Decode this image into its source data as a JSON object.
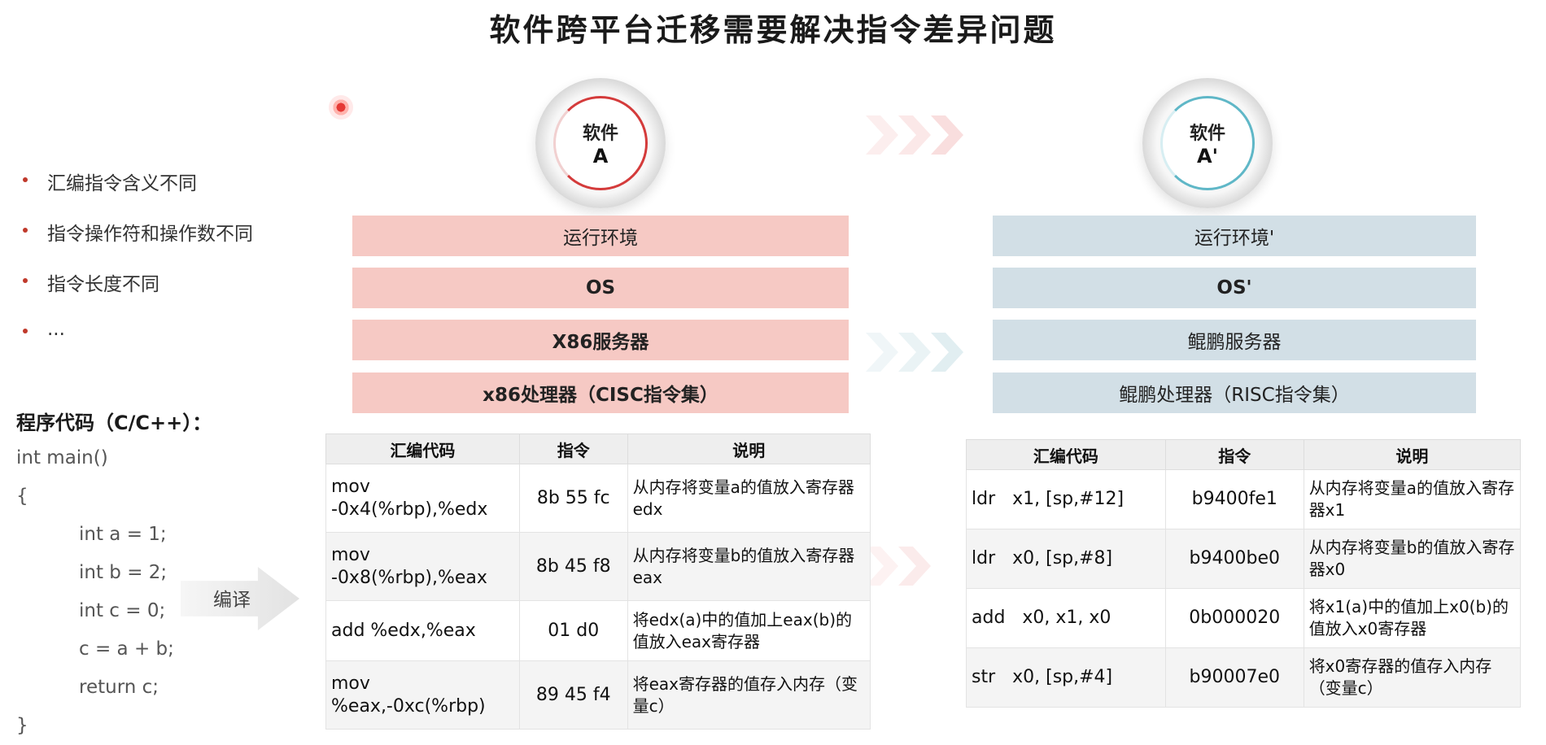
{
  "title": "软件跨平台迁移需要解决指令差异问题",
  "bullets": [
    "汇编指令含义不同",
    "指令操作符和操作数不同",
    "指令长度不同",
    "..."
  ],
  "code": {
    "title": "程序代码（C/C++）：",
    "lines": [
      "int main()",
      "{",
      "int a = 1;",
      "int b = 2;",
      "int c = 0;",
      "c = a + b;",
      "return c;",
      "}"
    ]
  },
  "compile_label": "编译",
  "left": {
    "software": {
      "line1": "软件",
      "line2": "A"
    },
    "layers": [
      "运行环境",
      "OS",
      "X86服务器",
      "x86处理器（CISC指令集）"
    ],
    "table": {
      "headers": [
        "汇编代码",
        "指令",
        "说明"
      ],
      "rows": [
        {
          "asm": "mov -0x4(%rbp),%edx",
          "code": "8b 55 fc",
          "desc": "从内存将变量a的值放入寄存器edx"
        },
        {
          "asm": "mov  -0x8(%rbp),%eax",
          "code": "8b 45 f8",
          "desc": "从内存将变量b的值放入寄存器eax"
        },
        {
          "asm": "add  %edx,%eax",
          "code": "01 d0",
          "desc": "将edx(a)中的值加上eax(b)的值放入eax寄存器"
        },
        {
          "asm": "mov %eax,-0xc(%rbp)",
          "code": "89 45 f4",
          "desc": "将eax寄存器的值存入内存（变量c）"
        }
      ]
    }
  },
  "right": {
    "software": {
      "line1": "软件",
      "line2": "A'"
    },
    "layers": [
      "运行环境'",
      "OS'",
      "鲲鹏服务器",
      "鲲鹏处理器（RISC指令集）"
    ],
    "table": {
      "headers": [
        "汇编代码",
        "指令",
        "说明"
      ],
      "rows": [
        {
          "asm": "ldr   x1, [sp,#12]",
          "code": "b9400fe1",
          "desc": "从内存将变量a的值放入寄存器x1"
        },
        {
          "asm": "ldr   x0, [sp,#8]",
          "code": "b9400be0",
          "desc": "从内存将变量b的值放入寄存器x0"
        },
        {
          "asm": "add   x0, x1, x0",
          "code": "0b000020",
          "desc": "将x1(a)中的值加上x0(b)的值放入x0寄存器"
        },
        {
          "asm": "str   x0, [sp,#4]",
          "code": "b90007e0",
          "desc": "将x0寄存器的值存入内存（变量c）"
        }
      ]
    }
  }
}
